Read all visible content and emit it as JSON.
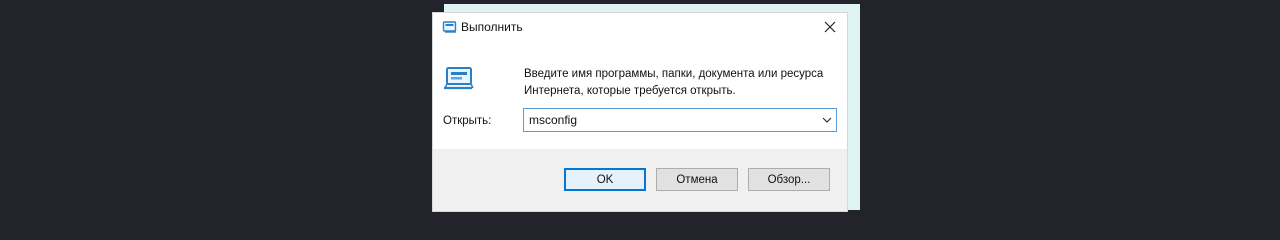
{
  "window": {
    "title": "Выполнить",
    "close_icon": "close-icon",
    "app_icon": "run-dialog-icon"
  },
  "content": {
    "description_line1": "Введите имя программы, папки, документа или ресурса",
    "description_line2": "Интернета, которые требуется открыть.",
    "open_label": "Открыть:",
    "open_value": "msconfig",
    "dropdown_icon": "chevron-down-icon"
  },
  "buttons": {
    "ok": "OK",
    "cancel": "Отмена",
    "browse": "Обзор..."
  },
  "colors": {
    "backdrop": "#23232b",
    "accent": "#0078d7",
    "footer": "#f0f0f0",
    "behind_panel": "#dff4f2"
  }
}
